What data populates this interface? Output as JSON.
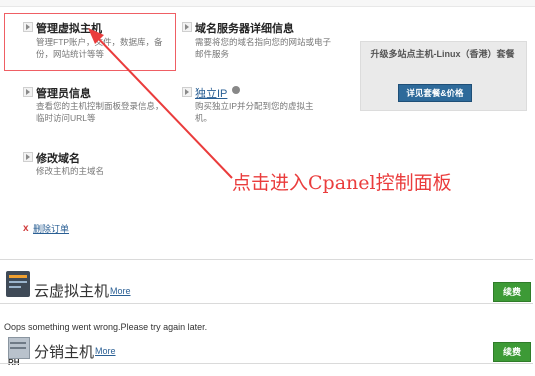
{
  "options": [
    {
      "title": "管理虚拟主机",
      "desc": "管理FTP账户，文件，数据库，备份，网站统计等等"
    },
    {
      "title": "域名服务器详细信息",
      "desc": "需要将您的域名指向您的网站或电子邮件服务"
    },
    {
      "title": "管理员信息",
      "desc": "查看您的主机控制面板登录信息，临时访问URL等"
    },
    {
      "title": "独立IP",
      "desc": "购买独立IP并分配到您的虚拟主机。"
    },
    {
      "title": "修改域名",
      "desc": "修改主机的主域名"
    }
  ],
  "promo": {
    "text": "升级多站点主机-Linux（香港）套餐",
    "button": "详见套餐&价格"
  },
  "annotation": "点击进入Cpanel控制面板",
  "delete_order": {
    "label": "删除订单"
  },
  "sections": [
    {
      "title": "云虚拟主机",
      "more": "More",
      "renew": "续费"
    },
    {
      "title": "分销主机",
      "more": "More",
      "renew": "续费",
      "icon_label": "RH"
    }
  ],
  "error_message": "Oops something went wrong.Please try again later.",
  "colors": {
    "highlight": "#ef5e64",
    "annotation": "#ea3c3c",
    "renew": "#3d9a36",
    "promo_button": "#2e6a9a"
  }
}
